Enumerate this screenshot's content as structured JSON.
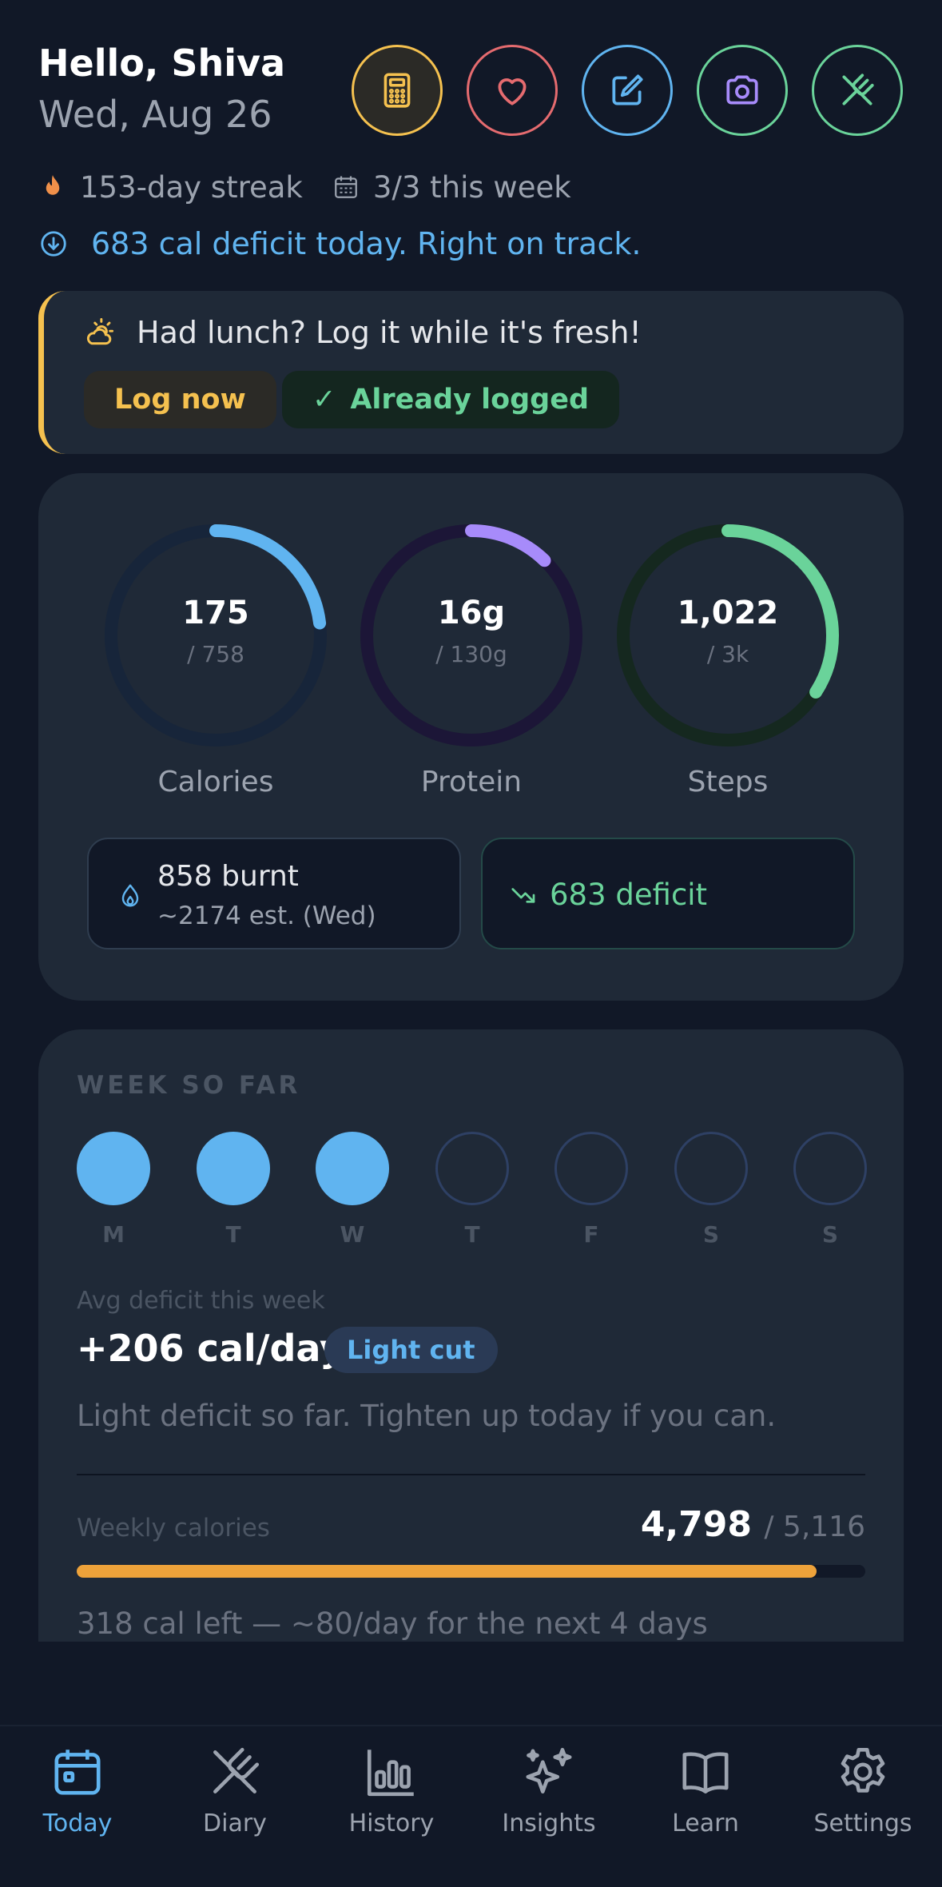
{
  "header": {
    "greeting": "Hello, Shiva",
    "date": "Wed, Aug 26"
  },
  "quick_actions": [
    {
      "name": "calculator-icon",
      "color": "#f5c14f"
    },
    {
      "name": "heart-icon",
      "color": "#e56b6f"
    },
    {
      "name": "edit-icon",
      "color": "#60b4f0"
    },
    {
      "name": "camera-icon",
      "color": "#a78bfa"
    },
    {
      "name": "utensils-icon",
      "color": "#6ad39a"
    }
  ],
  "streak": {
    "text": "153-day streak",
    "week_text": "3/3 this week"
  },
  "deficit_today": "683 cal deficit today. Right on track.",
  "reminder": {
    "text": "Had lunch? Log it while it's fresh!",
    "log_button": "Log now",
    "logged_button": "Already logged"
  },
  "rings": {
    "calories": {
      "value": "175",
      "goal": "/ 758",
      "label": "Calories",
      "fraction": 0.231,
      "color": "#60b4f0"
    },
    "protein": {
      "value": "16g",
      "goal": "/ 130g",
      "label": "Protein",
      "fraction": 0.123,
      "color": "#a78bfa"
    },
    "steps": {
      "value": "1,022",
      "goal": "/ 3k",
      "label": "Steps",
      "fraction": 0.341,
      "color": "#6ad39a"
    }
  },
  "burn": {
    "main": "858 burnt",
    "sub": "~2174 est. (Wed)"
  },
  "deficit_box": "683 deficit",
  "week": {
    "title": "WEEK SO FAR",
    "days": [
      {
        "label": "M",
        "done": true
      },
      {
        "label": "T",
        "done": true
      },
      {
        "label": "W",
        "done": true
      },
      {
        "label": "T",
        "done": false
      },
      {
        "label": "F",
        "done": false
      },
      {
        "label": "S",
        "done": false
      },
      {
        "label": "S",
        "done": false
      }
    ],
    "avg_label": "Avg deficit this week",
    "avg_value": "+206 cal/day",
    "badge": "Light cut",
    "note": "Light deficit so far. Tighten up today if you can.",
    "weekly_label": "Weekly calories",
    "weekly_value": "4,798",
    "weekly_goal": "/ 5,116",
    "weekly_fraction": 0.938,
    "left_note": "318 cal left — ~80/day for the next 4 days"
  },
  "nav": [
    {
      "label": "Today",
      "icon": "calendar-icon",
      "active": true
    },
    {
      "label": "Diary",
      "icon": "utensils-icon",
      "active": false
    },
    {
      "label": "History",
      "icon": "bar-chart-icon",
      "active": false
    },
    {
      "label": "Insights",
      "icon": "sparkles-icon",
      "active": false
    },
    {
      "label": "Learn",
      "icon": "book-icon",
      "active": false
    },
    {
      "label": "Settings",
      "icon": "gear-icon",
      "active": false
    }
  ]
}
